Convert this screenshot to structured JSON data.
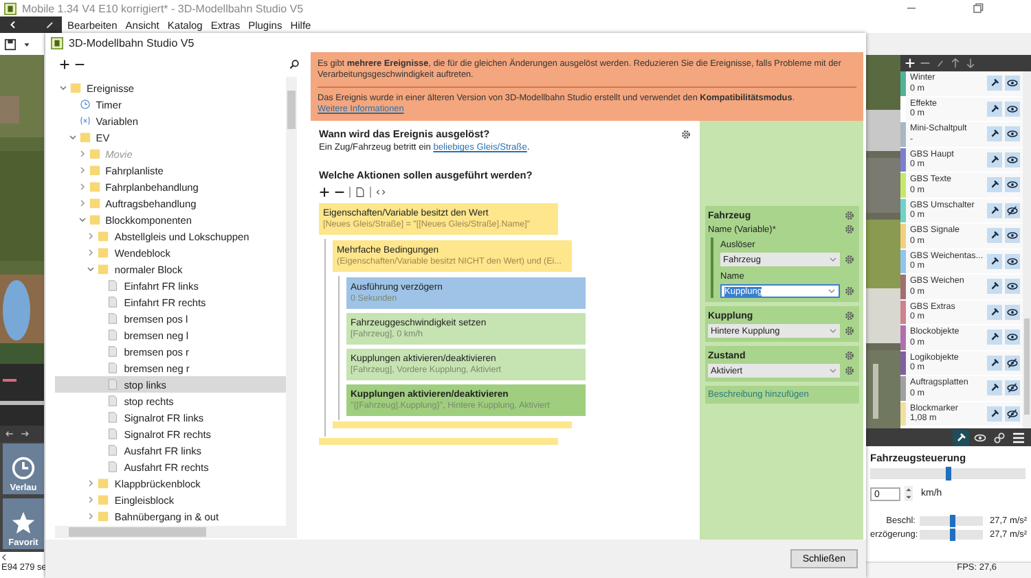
{
  "app": {
    "title": "Mobile 1.34 V4 E10 korrigiert* - 3D-Modellbahn Studio V5",
    "menu": [
      "Bearbeiten",
      "Ansicht",
      "Katalog",
      "Extras",
      "Plugins",
      "Hilfe"
    ],
    "tiles": [
      "Verlau",
      "Favorit"
    ],
    "status": "E94 279 se"
  },
  "dialog": {
    "title": "3D-Modellbahn Studio V5",
    "tree": [
      {
        "label": "Ereignisse",
        "kind": "folder",
        "expanded": true,
        "selected": false,
        "disabled": false,
        "children": [
          {
            "label": "Timer",
            "kind": "timer",
            "selected": false,
            "disabled": false
          },
          {
            "label": "Variablen",
            "kind": "variable",
            "selected": false,
            "disabled": false
          },
          {
            "label": "EV",
            "kind": "folder",
            "expanded": true,
            "selected": false,
            "disabled": false,
            "children": [
              {
                "label": "Movie",
                "kind": "folder",
                "expanded": false,
                "selected": false,
                "disabled": true
              },
              {
                "label": "Fahrplanliste",
                "kind": "folder",
                "expanded": false,
                "selected": false,
                "disabled": false
              },
              {
                "label": "Fahrplanbehandlung",
                "kind": "folder",
                "expanded": false,
                "selected": false,
                "disabled": false
              },
              {
                "label": "Auftragsbehandlung",
                "kind": "folder",
                "expanded": false,
                "selected": false,
                "disabled": false
              },
              {
                "label": "Blockkomponenten",
                "kind": "folder",
                "expanded": true,
                "selected": false,
                "disabled": false,
                "children": [
                  {
                    "label": "Abstellgleis und Lokschuppen",
                    "kind": "folder",
                    "expanded": false,
                    "selected": false,
                    "disabled": false
                  },
                  {
                    "label": "Wendeblock",
                    "kind": "folder",
                    "expanded": false,
                    "selected": false,
                    "disabled": false
                  },
                  {
                    "label": "normaler Block",
                    "kind": "folder",
                    "expanded": true,
                    "selected": false,
                    "disabled": false,
                    "children": [
                      {
                        "label": "Einfahrt FR links",
                        "kind": "event",
                        "selected": false,
                        "disabled": false
                      },
                      {
                        "label": "Einfahrt FR rechts",
                        "kind": "event",
                        "selected": false,
                        "disabled": false
                      },
                      {
                        "label": "bremsen pos l",
                        "kind": "event",
                        "selected": false,
                        "disabled": false
                      },
                      {
                        "label": "bremsen neg l",
                        "kind": "event",
                        "selected": false,
                        "disabled": false
                      },
                      {
                        "label": "bremsen pos r",
                        "kind": "event",
                        "selected": false,
                        "disabled": false
                      },
                      {
                        "label": "bremsen neg r",
                        "kind": "event",
                        "selected": false,
                        "disabled": false
                      },
                      {
                        "label": "stop links",
                        "kind": "event",
                        "selected": true,
                        "disabled": false
                      },
                      {
                        "label": "stop rechts",
                        "kind": "event",
                        "selected": false,
                        "disabled": false
                      },
                      {
                        "label": "Signalrot FR links",
                        "kind": "event",
                        "selected": false,
                        "disabled": false
                      },
                      {
                        "label": "Signalrot FR rechts",
                        "kind": "event",
                        "selected": false,
                        "disabled": false
                      },
                      {
                        "label": "Ausfahrt FR links",
                        "kind": "event",
                        "selected": false,
                        "disabled": false
                      },
                      {
                        "label": "Ausfahrt FR rechts",
                        "kind": "event",
                        "selected": false,
                        "disabled": false
                      }
                    ]
                  },
                  {
                    "label": "Klappbrückenblock",
                    "kind": "folder",
                    "expanded": false,
                    "selected": false,
                    "disabled": false
                  },
                  {
                    "label": "Eingleisblock",
                    "kind": "folder",
                    "expanded": false,
                    "selected": false,
                    "disabled": false
                  },
                  {
                    "label": "Bahnübergang in & out",
                    "kind": "folder",
                    "expanded": false,
                    "selected": false,
                    "disabled": false
                  }
                ]
              }
            ]
          }
        ]
      }
    ],
    "notices": [
      {
        "text": "Es gibt **mehrere Ereignisse**, die für die gleichen Änderungen ausgelöst werden. Reduzieren Sie die Ereignisse, falls Probleme mit der Verarbeitungsgeschwindigkeit auftreten."
      },
      {
        "text": "Das Ereignis wurde in einer älteren Version von 3D-Modellbahn Studio erstellt und verwendet den **Kompatibilitätsmodus**.",
        "link": "Weitere Informationen"
      }
    ],
    "trigger": {
      "heading": "Wann wird das Ereignis ausgelöst?",
      "before": "Ein Zug/Fahrzeug betritt ein",
      "link": "beliebiges Gleis/Straße",
      "after": "."
    },
    "actions_heading": "Welche Aktionen sollen ausgeführt werden?",
    "actions": [
      {
        "kind": "condition",
        "title": "Eigenschaften/Variable besitzt den Wert",
        "detail": "[Neues Gleis/Straße] = \"[[Neues Gleis/Straße].Name]\"",
        "selected": false,
        "children": [
          {
            "kind": "condition",
            "title": "Mehrfache Bedingungen",
            "detail": "(Eigenschaften/Variable besitzt NICHT den Wert) und (Ei...",
            "selected": false,
            "children": [
              {
                "kind": "delay",
                "title": "Ausführung verzögern",
                "detail": "0 Sekunden",
                "selected": false
              },
              {
                "kind": "action",
                "title": "Fahrzeuggeschwindigkeit setzen",
                "detail": "[Fahrzeug], 0 km/h",
                "selected": false
              },
              {
                "kind": "action",
                "title": "Kupplungen aktivieren/deaktivieren",
                "detail": "[Fahrzeug], Vordere Kupplung, Aktiviert",
                "selected": false
              },
              {
                "kind": "action",
                "title": "Kupplungen aktivieren/deaktivieren",
                "detail": "\"{[Fahrzeug].Kupplung}\", Hintere Kupplung, Aktiviert",
                "selected": true
              }
            ]
          }
        ]
      }
    ],
    "properties": [
      {
        "title": "Fahrzeug",
        "subtitle": "Name (Variable)*",
        "fields": [
          {
            "label": "Auslöser",
            "kind": "select",
            "value": "Fahrzeug",
            "text_selected": false
          },
          {
            "label": "Name",
            "kind": "combo",
            "value": "Kupplung",
            "text_selected": true
          }
        ]
      },
      {
        "title": "Kupplung",
        "fields": [
          {
            "kind": "select",
            "value": "Hintere Kupplung",
            "text_selected": false
          }
        ]
      },
      {
        "title": "Zustand",
        "fields": [
          {
            "kind": "select",
            "value": "Aktiviert",
            "text_selected": false
          }
        ]
      }
    ],
    "add_description": "Beschreibung hinzufügen",
    "close_button": "Schließen"
  },
  "layers": [
    {
      "name": "Winter",
      "distance": "0 m",
      "color": "#4fb39a",
      "visible": true
    },
    {
      "name": "Effekte",
      "distance": "0 m",
      "color": "#ffffff",
      "visible": true
    },
    {
      "name": "Mini-Schaltpult",
      "distance": "-",
      "color": "#a9b8c0",
      "visible": true
    },
    {
      "name": "GBS Haupt",
      "distance": "0 m",
      "color": "#7b7fd0",
      "visible": true
    },
    {
      "name": "GBS Texte",
      "distance": "0 m",
      "color": "#c6e86a",
      "visible": true
    },
    {
      "name": "GBS Umschalter",
      "distance": "0 m",
      "color": "#6fd3c8",
      "visible": false
    },
    {
      "name": "GBS Signale",
      "distance": "0 m",
      "color": "#f0d080",
      "visible": true
    },
    {
      "name": "GBS Weichentas...",
      "distance": "0 m",
      "color": "#8fc4f0",
      "visible": true
    },
    {
      "name": "GBS Weichen",
      "distance": "0 m",
      "color": "#a07070",
      "visible": true
    },
    {
      "name": "GBS Extras",
      "distance": "0 m",
      "color": "#d08090",
      "visible": true
    },
    {
      "name": "Blockobjekte",
      "distance": "0 m",
      "color": "#b070b0",
      "visible": true
    },
    {
      "name": "Logikobjekte",
      "distance": "0 m",
      "color": "#8060a0",
      "visible": false
    },
    {
      "name": "Auftragsplatten",
      "distance": "0 m",
      "color": "#a0a0a0",
      "visible": false
    },
    {
      "name": "Blockmarker",
      "distance": "1,08 m",
      "color": "#f0e0a0",
      "visible": false
    }
  ],
  "vehicle_control": {
    "title": "Fahrzeugsteuerung",
    "speed": {
      "level": 0.5
    },
    "speed_value": "0",
    "unit": "km/h",
    "rows": [
      {
        "label": "Beschl:",
        "level": 0.52,
        "reading": "27,7 m/s²"
      },
      {
        "label": "erzögerung:",
        "level": 0.52,
        "reading": "27,7 m/s²"
      }
    ],
    "fps": "FPS: 27,6"
  }
}
